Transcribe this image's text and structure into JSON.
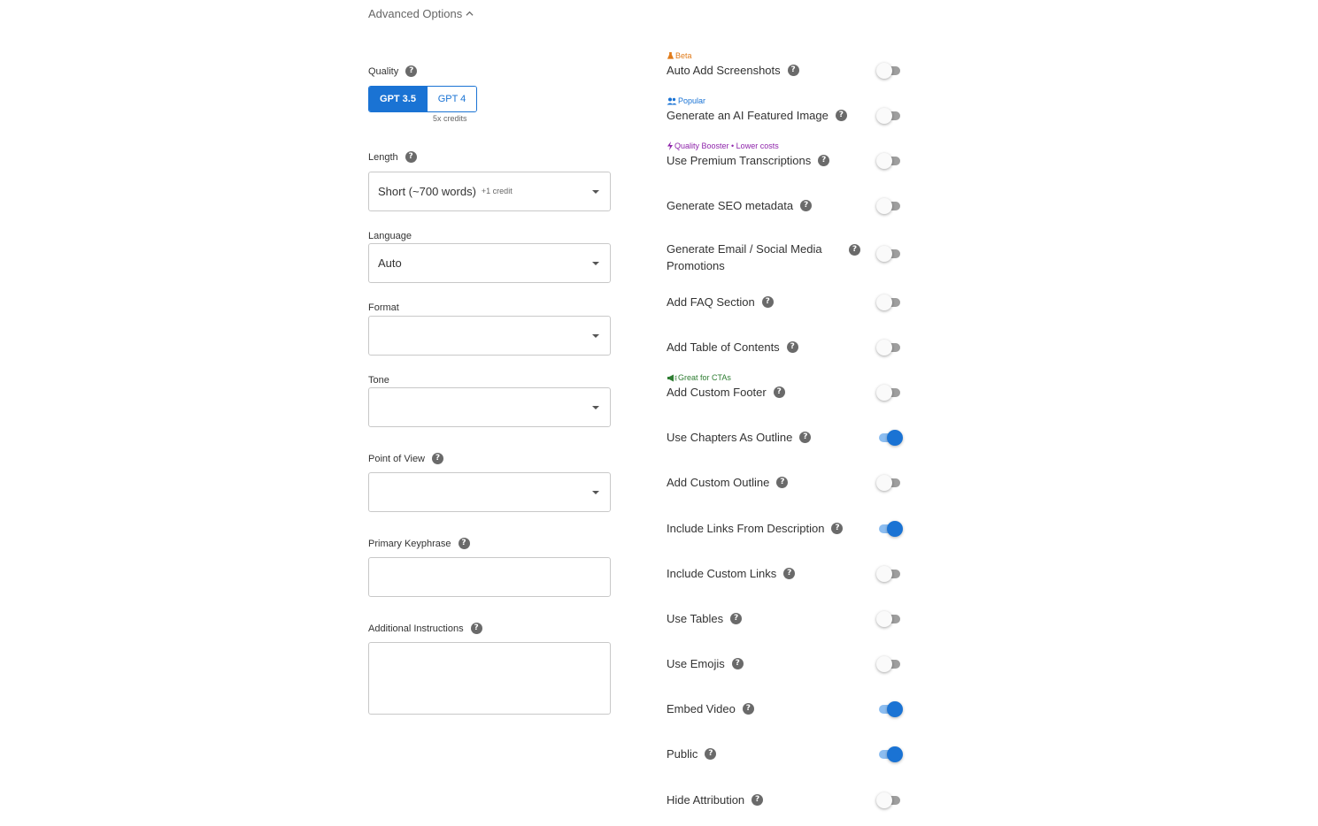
{
  "advanced_options": {
    "label": "Advanced Options"
  },
  "quality": {
    "label": "Quality",
    "options": [
      "GPT 3.5",
      "GPT 4"
    ],
    "selected": "GPT 3.5",
    "note": "5x credits"
  },
  "length": {
    "label": "Length",
    "value": "Short (~700 words)",
    "extra": "+1 credit"
  },
  "language": {
    "label": "Language",
    "value": "Auto"
  },
  "format": {
    "label": "Format",
    "value": ""
  },
  "tone": {
    "label": "Tone",
    "value": ""
  },
  "point_of_view": {
    "label": "Point of View",
    "value": ""
  },
  "primary_keyphrase": {
    "label": "Primary Keyphrase",
    "value": ""
  },
  "additional_instructions": {
    "label": "Additional Instructions",
    "value": ""
  },
  "options": [
    {
      "label": "Auto Add Screenshots",
      "on": false,
      "badge": "Beta",
      "badge_color": "#e07b1a",
      "badge_icon": "flask-icon"
    },
    {
      "label": "Generate an AI Featured Image",
      "on": false,
      "badge": "Popular",
      "badge_color": "#1a73d4",
      "badge_icon": "people-icon"
    },
    {
      "label": "Use Premium Transcriptions",
      "on": false,
      "badge": "Quality Booster • Lower costs",
      "badge_color": "#8e24aa",
      "badge_icon": "lightning-icon"
    },
    {
      "label": "Generate SEO metadata",
      "on": false
    },
    {
      "label": "Generate Email / Social Media Promotions",
      "on": false
    },
    {
      "label": "Add FAQ Section",
      "on": false
    },
    {
      "label": "Add Table of Contents",
      "on": false
    },
    {
      "label": "Add Custom Footer",
      "on": false,
      "badge": "Great for CTAs",
      "badge_color": "#2e7d32",
      "badge_icon": "megaphone-icon"
    },
    {
      "label": "Use Chapters As Outline",
      "on": true
    },
    {
      "label": "Add Custom Outline",
      "on": false
    },
    {
      "label": "Include Links From Description",
      "on": true
    },
    {
      "label": "Include Custom Links",
      "on": false
    },
    {
      "label": "Use Tables",
      "on": false
    },
    {
      "label": "Use Emojis",
      "on": false
    },
    {
      "label": "Embed Video",
      "on": true
    },
    {
      "label": "Public",
      "on": true
    },
    {
      "label": "Hide Attribution",
      "on": false
    }
  ],
  "colors": {
    "primary": "#1a73d4",
    "toggle_on_track": "#8cbdf0",
    "toggle_off_track": "#9e9e9e"
  }
}
